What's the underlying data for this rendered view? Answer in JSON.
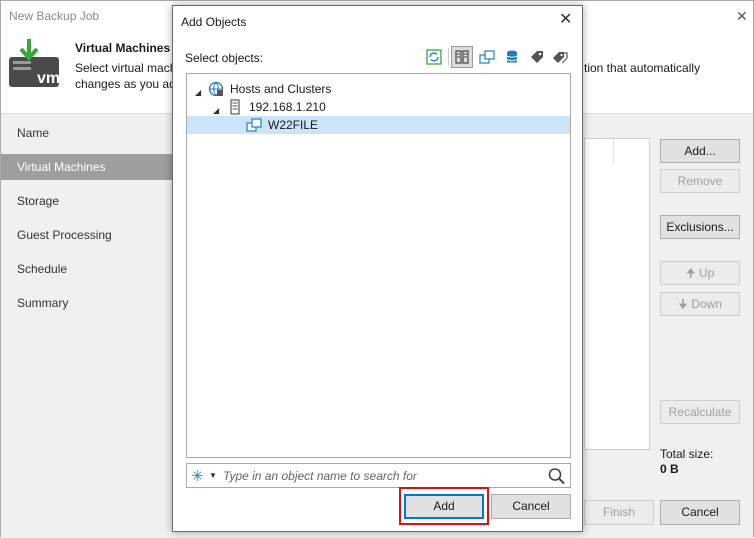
{
  "window": {
    "title": "New Backup Job",
    "header_title": "Virtual Machines",
    "desc_line1_left": "Select virtual mach",
    "desc_line1_right": "tion that automatically",
    "desc_line2": "changes as you ad",
    "brand_badge": "vm"
  },
  "nav": {
    "items": [
      "Name",
      "Virtual Machines",
      "Storage",
      "Guest Processing",
      "Schedule",
      "Summary"
    ],
    "active_index": 1
  },
  "side_buttons": {
    "add": "Add...",
    "remove": "Remove",
    "exclusions": "Exclusions...",
    "up": "Up",
    "down": "Down",
    "recalculate": "Recalculate"
  },
  "total": {
    "label": "Total size:",
    "value": "0 B"
  },
  "footer": {
    "finish": "Finish",
    "cancel": "Cancel"
  },
  "dialog": {
    "title": "Add Objects",
    "select_label": "Select objects:",
    "tree": [
      {
        "label": "Hosts and Clusters",
        "icon": "vcenter-icon",
        "level": 0,
        "expanded": true
      },
      {
        "label": "192.168.1.210",
        "icon": "host-icon",
        "level": 1,
        "expanded": true
      },
      {
        "label": "W22FILE",
        "icon": "vm-icon",
        "level": 2,
        "selected": true
      }
    ],
    "search_placeholder": "Type in an object name to search for",
    "add_button": "Add",
    "cancel_button": "Cancel"
  },
  "colors": {
    "accent_blue": "#1c7dc8",
    "selection": "#cde3f7",
    "highlight_red": "#dd1111",
    "nav_active": "#9e9e9e"
  }
}
